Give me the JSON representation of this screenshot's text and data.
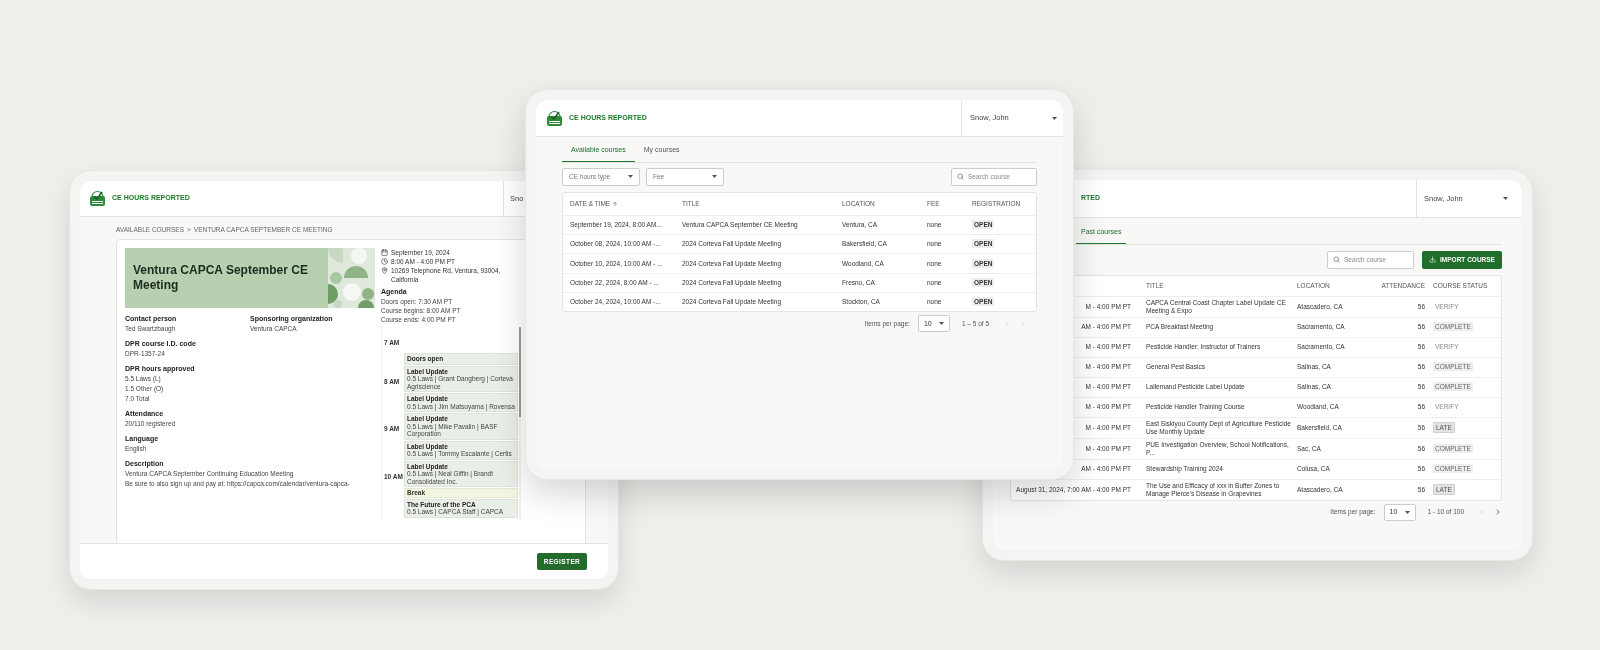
{
  "left_screen": {
    "brand": "CE HOURS REPORTED",
    "user_partial": "Sno",
    "breadcrumb": [
      "AVAILABLE COURSES",
      "VENTURA CAPCA SEPTEMBER CE MEETING"
    ],
    "breadcrumb_separator": ">",
    "course_title": "Ventura CAPCA September CE Meeting",
    "details_pair": [
      {
        "label": "Contact person",
        "values": [
          "Ted Swartzbaugh"
        ]
      },
      {
        "label": "Sponsoring organization",
        "values": [
          "Ventura CAPCA"
        ]
      }
    ],
    "details": [
      {
        "label": "DPR course I.D. code",
        "values": [
          "DPR-1357-24"
        ]
      },
      {
        "label": "DPR hours approved",
        "values": [
          "5.5 Laws (L)",
          "1.5 Other (O)",
          "7.0 Total"
        ]
      },
      {
        "label": "Attendance",
        "values": [
          "20/110 registered"
        ]
      },
      {
        "label": "Language",
        "values": [
          "English"
        ]
      },
      {
        "label": "Description",
        "values": [
          "Ventura CAPCA September Continuing Education Meeting",
          "Be sure to also sign up and pay at: https://capca.com/calendar/ventura-capca-"
        ]
      }
    ],
    "info": [
      {
        "kind": "date",
        "text": "September 19, 2024"
      },
      {
        "kind": "time",
        "text": "8:00 AM - 4:00 PM PT"
      },
      {
        "kind": "location",
        "text": "10269 Telephone Rd, Ventura, 93004, California"
      }
    ],
    "agenda": {
      "heading": "Agenda",
      "lines": [
        "Doors open: 7:30 AM PT",
        "Course begins: 8:00 AM PT",
        "Course ends: 4:00 PM PT"
      ],
      "calendar": [
        {
          "kind": "empty",
          "time": "7 AM"
        },
        {
          "kind": "session",
          "title": "Doors open"
        },
        {
          "kind": "session",
          "time": "8 AM",
          "title": "Label Update",
          "detail": "0.5 Laws | Grant Dangberg | Corteva Agriscience"
        },
        {
          "kind": "session",
          "title": "Label Update",
          "detail": "0.5 Laws | Jim Matsuyama | Rovensa"
        },
        {
          "kind": "session",
          "time": "9 AM",
          "title": "Label Update",
          "detail": "0.5 Laws | Mike Pavalin | BASF Corporation"
        },
        {
          "kind": "session",
          "title": "Label Update",
          "detail": "0.5 Laws | Tommy Escalante | Certis"
        },
        {
          "kind": "session",
          "time": "10 AM",
          "title": "Label Update",
          "detail": "0.5 Laws | Neal Giffin | Brandt Consolidated Inc."
        },
        {
          "kind": "break",
          "title": "Break"
        },
        {
          "kind": "session",
          "title": "The Future of the PCA",
          "detail": "0.5 Laws | CAPCA Staff | CAPCA"
        }
      ]
    },
    "register_button": "REGISTER"
  },
  "center_screen": {
    "brand": "CE HOURS REPORTED",
    "user": "Snow, John",
    "tabs": [
      {
        "label": "Available courses",
        "selected": true
      },
      {
        "label": "My courses",
        "selected": false
      }
    ],
    "filters": [
      {
        "placeholder": "CE hours type"
      },
      {
        "placeholder": "Fee"
      }
    ],
    "search": {
      "placeholder": "Search course"
    },
    "table": {
      "columns": [
        {
          "label": "DATE & TIME",
          "sorted": true
        },
        {
          "label": "TITLE",
          "sorted": false
        },
        {
          "label": "LOCATION",
          "sorted": false
        },
        {
          "label": "FEE",
          "sorted": false
        },
        {
          "label": "REGISTRATION",
          "sorted": false
        }
      ],
      "rows": [
        {
          "date": "September 19, 2024, 8:00 AM...",
          "title": "Ventura CAPCA September CE Meeting",
          "location": "Ventura, CA",
          "fee": "none",
          "registration": "OPEN"
        },
        {
          "date": "October 08, 2024, 10:00 AM -...",
          "title": "2024 Corteva Fall Update Meeting",
          "location": "Bakersfield, CA",
          "fee": "none",
          "registration": "OPEN"
        },
        {
          "date": "October 10, 2024, 10:00 AM - ...",
          "title": "2024 Corteva Fall Update Meeting",
          "location": "Woodland, CA",
          "fee": "none",
          "registration": "OPEN"
        },
        {
          "date": "October 22, 2024, 8:00 AM - ...",
          "title": "2024 Corteva Fall Update Meeting",
          "location": "Fresno, CA",
          "fee": "none",
          "registration": "OPEN"
        },
        {
          "date": "October 24, 2024, 10:00 AM -...",
          "title": "2024 Corteva Fall Update Meeting",
          "location": "Stockton, CA",
          "fee": "none",
          "registration": "OPEN"
        }
      ]
    },
    "pagination": {
      "label": "Items per page:",
      "page_size": "10",
      "range": "1 – 5 of 5",
      "prev_disabled": true,
      "next_disabled": true
    }
  },
  "right_screen": {
    "brand_partial": "RTED",
    "user": "Snow, John",
    "tabs": [
      {
        "label": "Past courses",
        "selected": true
      }
    ],
    "search": {
      "placeholder": "Search course"
    },
    "import_button": "IMPORT COURSE",
    "table": {
      "columns": [
        {
          "label": "TITLE"
        },
        {
          "label": "LOCATION"
        },
        {
          "label": "ATTENDANCE"
        },
        {
          "label": "COURSE STATUS"
        }
      ],
      "rows": [
        {
          "date": "M - 4:00 PM PT",
          "title": "CAPCA Central Coast Chapter Label Update CE Meeting & Expo",
          "location": "Atascadero, CA",
          "attendance": "56",
          "status": {
            "label": "VERIFY",
            "kind": "verify"
          }
        },
        {
          "date": "AM - 4:00 PM PT",
          "title": "PCA Breakfast Meeting",
          "location": "Sacramento, CA",
          "attendance": "56",
          "status": {
            "label": "COMPLETE",
            "kind": "complete"
          }
        },
        {
          "date": "M - 4:00 PM PT",
          "title": "Pesticide Handler: Instructor of Trainers",
          "location": "Sacramento, CA",
          "attendance": "56",
          "status": {
            "label": "VERIFY",
            "kind": "verify"
          }
        },
        {
          "date": "M - 4:00 PM PT",
          "title": "General Pest Basics",
          "location": "Salinas, CA",
          "attendance": "56",
          "status": {
            "label": "COMPLETE",
            "kind": "complete"
          }
        },
        {
          "date": "M - 4:00 PM PT",
          "title": "Lallemand Pesticide Label Update",
          "location": "Salinas, CA",
          "attendance": "56",
          "status": {
            "label": "COMPLETE",
            "kind": "complete"
          }
        },
        {
          "date": "M - 4:00 PM PT",
          "title": "Pesticide Handler Training Course",
          "location": "Woodland, CA",
          "attendance": "56",
          "status": {
            "label": "VERIFY",
            "kind": "verify"
          }
        },
        {
          "date": "M - 4:00 PM PT",
          "title": "East Siskiyou County Dept of Agriculture Pesticide Use Monthly Update",
          "location": "Bakersfield, CA",
          "attendance": "56",
          "status": {
            "label": "LATE",
            "kind": "late"
          }
        },
        {
          "date": "M - 4:00 PM PT",
          "title": "PUE Investigation Overview, School Notifications, P...",
          "location": "Sac, CA",
          "attendance": "56",
          "status": {
            "label": "COMPLETE",
            "kind": "complete"
          }
        },
        {
          "date": "AM - 4:00 PM PT",
          "title": "Stewardship Training 2024",
          "location": "Colusa, CA",
          "attendance": "56",
          "status": {
            "label": "COMPLETE",
            "kind": "complete"
          }
        },
        {
          "date": "August 31, 2024, 7:00 AM - 4:00 PM PT",
          "title": "The Use and Efficacy of xxx in Buffer Zones to Manage Pierce's Disease in Grapevines",
          "location": "Atascadero, CA",
          "attendance": "56",
          "status": {
            "label": "LATE",
            "kind": "late"
          }
        }
      ]
    },
    "pagination": {
      "label": "Items per page:",
      "page_size": "10",
      "range": "1 - 10 of 100",
      "prev_disabled": true,
      "next_disabled": false
    }
  }
}
